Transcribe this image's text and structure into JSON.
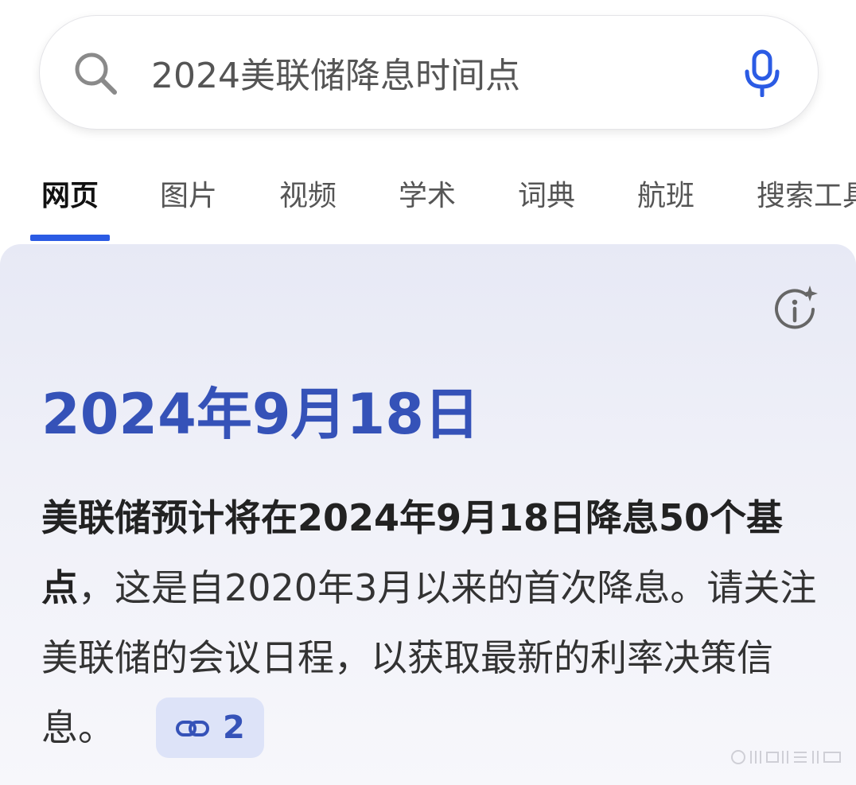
{
  "search": {
    "query": "2024美联储降息时间点",
    "icon": "search-icon",
    "mic_icon": "microphone-icon"
  },
  "tabs": [
    {
      "label": "网页",
      "active": true
    },
    {
      "label": "图片"
    },
    {
      "label": "视频"
    },
    {
      "label": "学术"
    },
    {
      "label": "词典"
    },
    {
      "label": "航班"
    },
    {
      "label": "搜索工具"
    }
  ],
  "answer": {
    "title": "2024年9月18日",
    "body_bold": "美联储预计将在2024年9月18日降息50个基点",
    "body_rest": "，这是自2020年3月以来的首次降息。请关注美联储的会议日程，以获取最新的利率决策信息。",
    "citation_count": "2",
    "info_icon": "ai-info-sparkle-icon"
  },
  "colors": {
    "accent": "#2b5be4",
    "title": "#3552b8",
    "card_bg": "#eaecf6",
    "citation_bg": "#dde3f8"
  }
}
